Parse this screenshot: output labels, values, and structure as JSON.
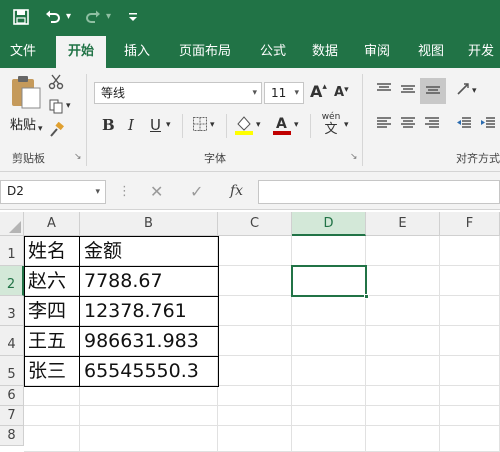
{
  "quick_access": {
    "save_icon": "save-icon",
    "undo_icon": "undo-icon",
    "redo_icon": "redo-icon",
    "customize_icon": "customize-icon"
  },
  "tabs": [
    {
      "label": "文件"
    },
    {
      "label": "开始"
    },
    {
      "label": "插入"
    },
    {
      "label": "页面布局"
    },
    {
      "label": "公式"
    },
    {
      "label": "数据"
    },
    {
      "label": "审阅"
    },
    {
      "label": "视图"
    },
    {
      "label": "开发"
    }
  ],
  "ribbon": {
    "clipboard": {
      "paste_label": "粘贴",
      "group_label": "剪贴板"
    },
    "font": {
      "font_name": "等线",
      "font_size": "11",
      "bold": "B",
      "italic": "I",
      "underline": "U",
      "grow": "A",
      "shrink": "A",
      "wen_top": "wén",
      "wen_bottom": "文",
      "group_label": "字体"
    },
    "alignment": {
      "group_label": "对齐方式"
    }
  },
  "formula_bar": {
    "name_box": "D2",
    "fx_label": "fx",
    "content": ""
  },
  "grid": {
    "columns": [
      "A",
      "B",
      "C",
      "D",
      "E",
      "F"
    ],
    "rows": [
      "1",
      "2",
      "3",
      "4",
      "5",
      "6",
      "7",
      "8"
    ],
    "selected_cell": "D2",
    "table": [
      {
        "a": "姓名",
        "b": "金额"
      },
      {
        "a": "赵六",
        "b": "7788.67"
      },
      {
        "a": "李四",
        "b": "12378.761"
      },
      {
        "a": "王五",
        "b": "986631.983"
      },
      {
        "a": "张三",
        "b": "65545550.3"
      }
    ]
  },
  "colors": {
    "excel_green": "#217346",
    "selection_border": "#217346",
    "font_color_underline": "#c00000",
    "highlight_underline": "#ffff00"
  }
}
